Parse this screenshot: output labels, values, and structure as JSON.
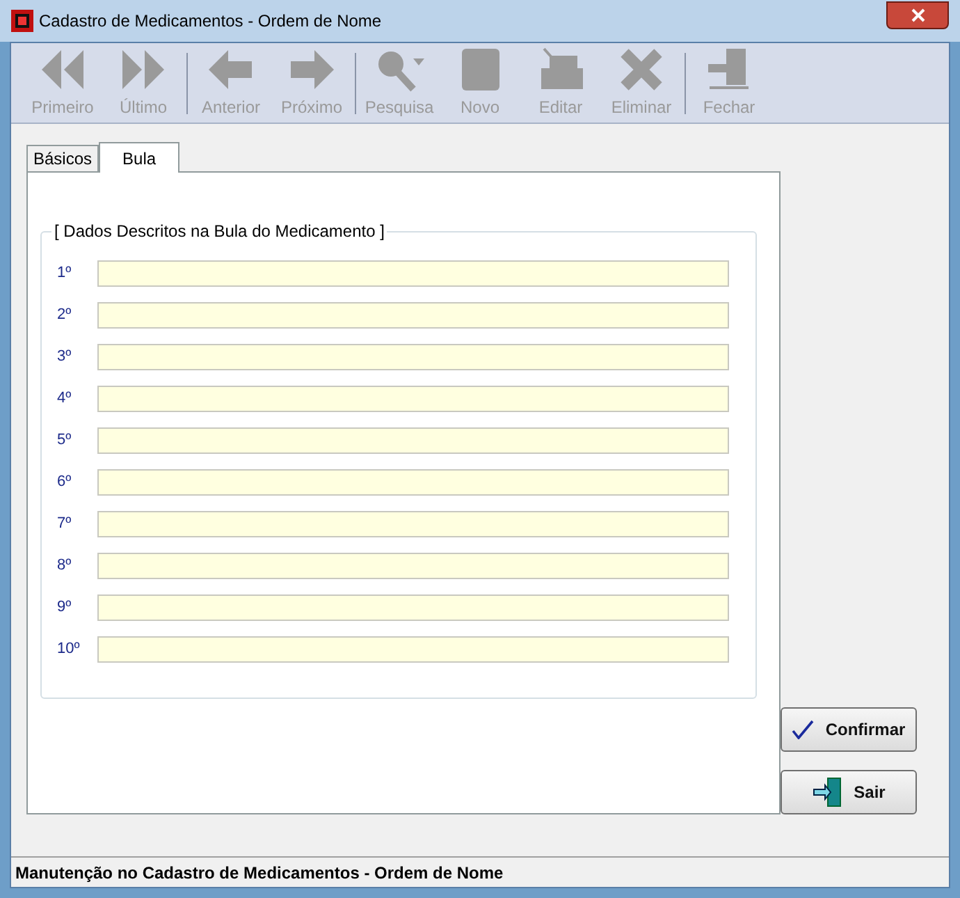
{
  "window": {
    "title": "Cadastro de Medicamentos - Ordem de Nome"
  },
  "toolbar": [
    {
      "label": "Primeiro",
      "kind": "first",
      "disabled": true
    },
    {
      "label": "Último",
      "kind": "last",
      "disabled": true
    },
    {
      "label": "Anterior",
      "kind": "prev",
      "disabled": true
    },
    {
      "label": "Próximo",
      "kind": "next",
      "disabled": true
    },
    {
      "label": "Pesquisa",
      "kind": "search",
      "disabled": true
    },
    {
      "label": "Novo",
      "kind": "new",
      "disabled": true
    },
    {
      "label": "Editar",
      "kind": "edit",
      "disabled": true
    },
    {
      "label": "Eliminar",
      "kind": "delete",
      "disabled": true
    },
    {
      "label": "Fechar",
      "kind": "close",
      "disabled": true
    }
  ],
  "tabs": [
    {
      "label": "Básicos",
      "selected": false
    },
    {
      "label": "Bula",
      "selected": true
    }
  ],
  "group": {
    "title": "[ Dados Descritos na Bula do Medicamento ]",
    "fields": [
      {
        "label": "1º"
      },
      {
        "label": "2º"
      },
      {
        "label": "3º"
      },
      {
        "label": "4º"
      },
      {
        "label": "5º"
      },
      {
        "label": "6º"
      },
      {
        "label": "7º"
      },
      {
        "label": "8º"
      },
      {
        "label": "9º"
      },
      {
        "label": "10º"
      }
    ]
  },
  "buttons": [
    {
      "label": "Confirmar",
      "kind": "confirm"
    },
    {
      "label": "Sair",
      "kind": "exit"
    }
  ],
  "status_bar": "Manutenção no Cadastro de Medicamentos - Ordem de Nome"
}
